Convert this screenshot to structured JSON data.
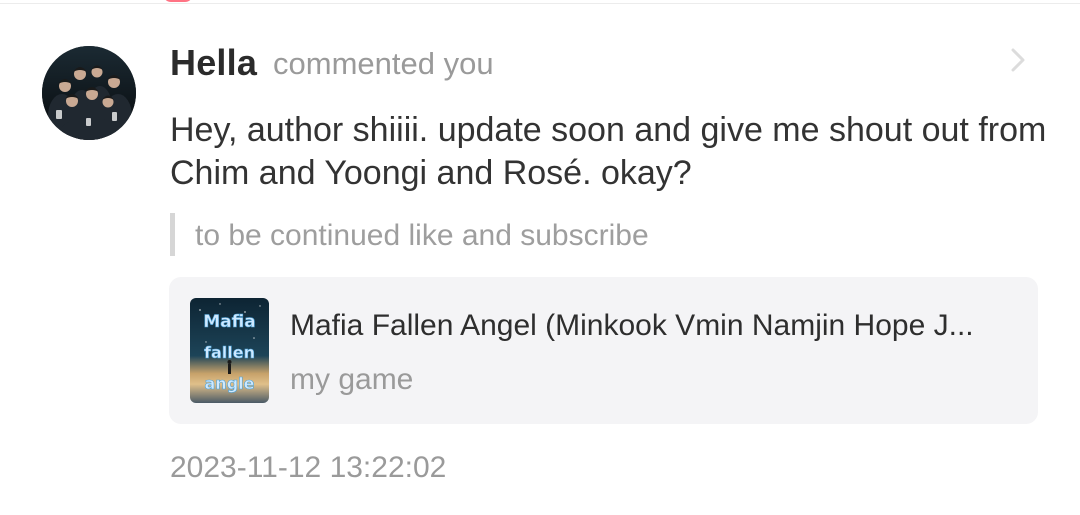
{
  "notification": {
    "user_name": "Hella",
    "action_text": "commented you",
    "comment_text": "Hey, author shiiii. update soon and give me shout out from Chim and Yoongi and Rosé. okay?",
    "quoted_text": "to be continued like and subscribe",
    "timestamp": "2023-11-12 13:22:02"
  },
  "story_card": {
    "title": "Mafia Fallen Angel (Minkook Vmin Namjin Hope J...",
    "subtitle": "my game",
    "cover_text": [
      "Mafia",
      "fallen",
      "angle"
    ]
  },
  "icons": {
    "avatar": "user-avatar",
    "chevron": "chevron-right-icon",
    "cover": "story-cover-image"
  },
  "colors": {
    "name": "#2b2b2b",
    "secondary_text": "#9a9a9a",
    "card_background": "#f4f4f6",
    "quote_bar": "#d6d6d6",
    "accent": "#ff5a6e"
  }
}
